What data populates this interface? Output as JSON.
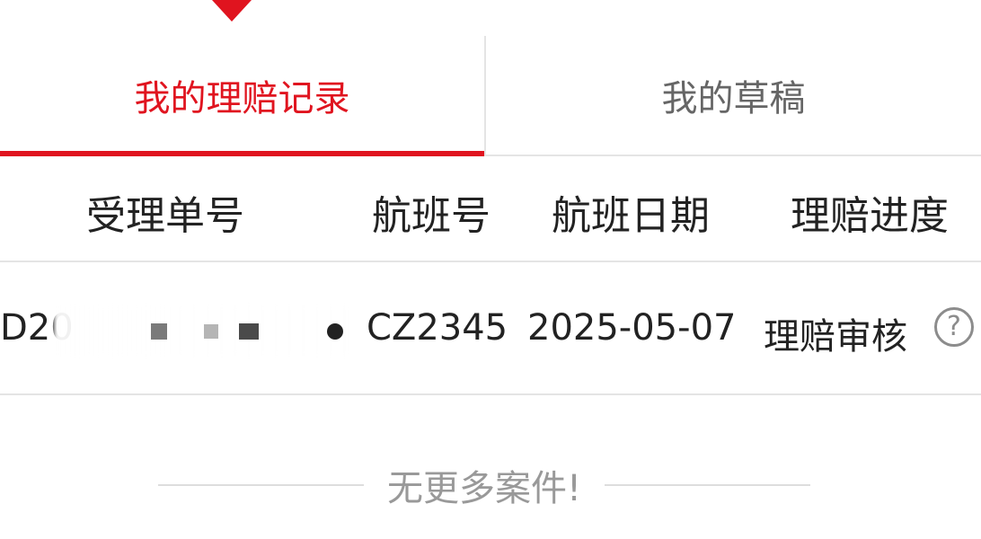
{
  "tabs": [
    {
      "label": "我的理赔记录",
      "active": true
    },
    {
      "label": "我的草稿",
      "active": false
    }
  ],
  "table": {
    "headers": [
      "受理单号",
      "航班号",
      "航班日期",
      "理赔进度"
    ],
    "rows": [
      {
        "order_no": "D20",
        "flight_no": "CZ2345",
        "flight_date": "2025-05-07",
        "status": "理赔审核"
      }
    ]
  },
  "help_icon": {
    "glyph": "?",
    "icon": "question-circle-icon"
  },
  "footer": {
    "no_more_text": "无更多案件!"
  },
  "colors": {
    "accent": "#e0141f",
    "muted_text": "#999999",
    "divider": "#e4e4e4"
  }
}
